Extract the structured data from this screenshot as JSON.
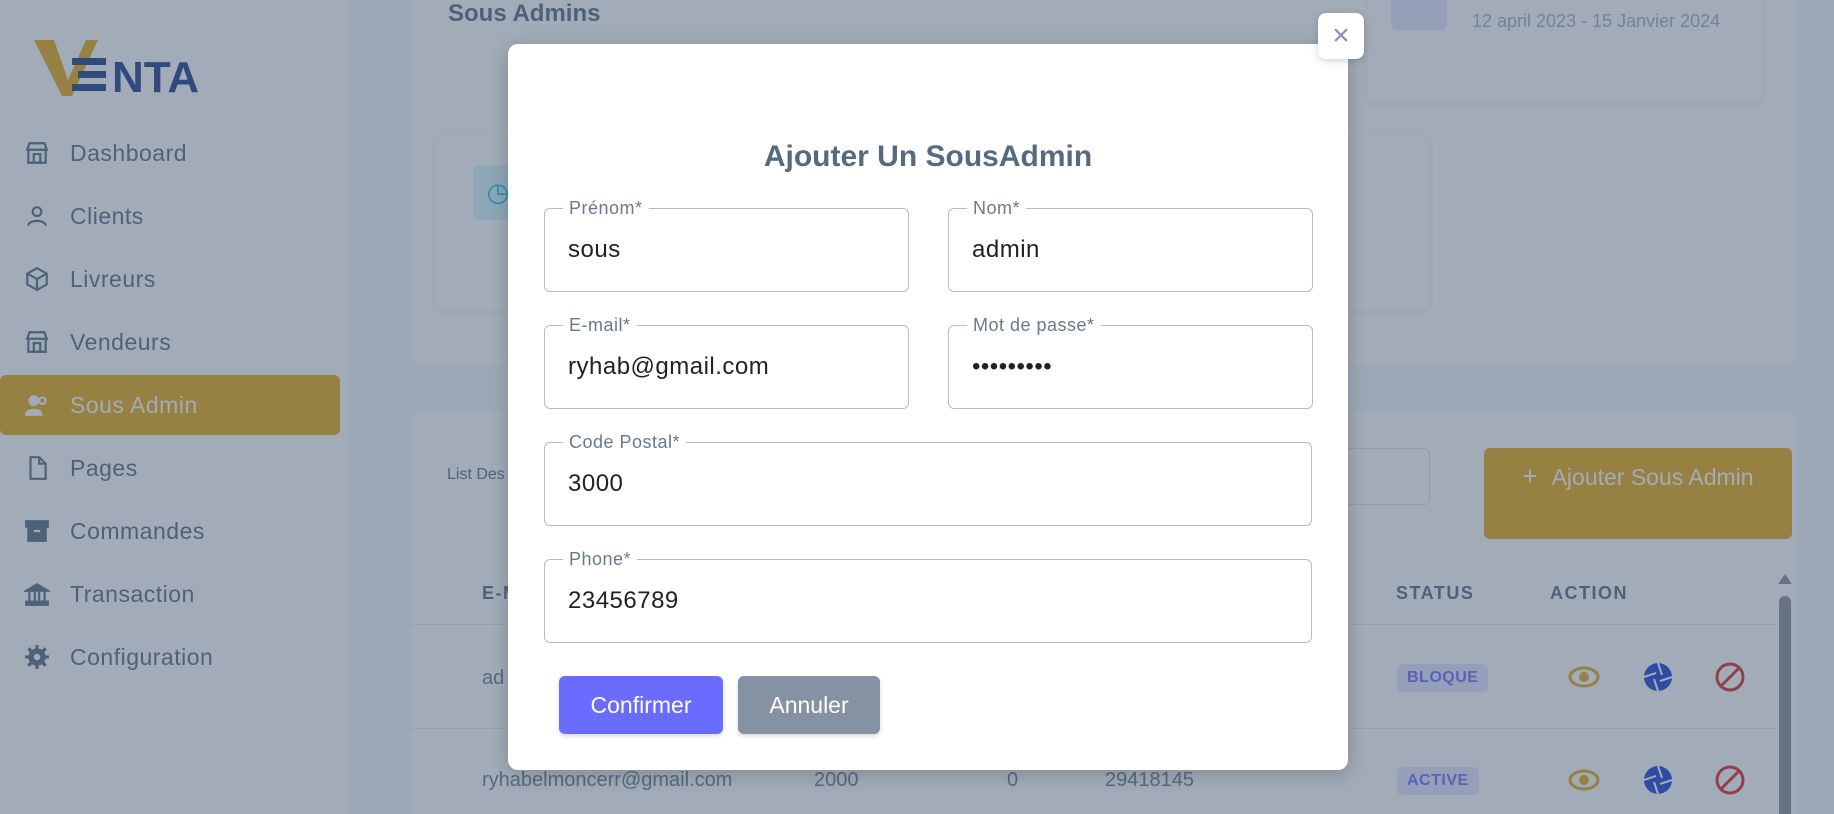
{
  "brand": {
    "logo_text": "VENTA",
    "accent": "#e8a814",
    "dark": "#1e3a8a"
  },
  "sidebar": {
    "items": [
      {
        "label": "Dashboard",
        "icon": "store-icon",
        "active": false
      },
      {
        "label": "Clients",
        "icon": "user-icon",
        "active": false
      },
      {
        "label": "Livreurs",
        "icon": "box-icon",
        "active": false
      },
      {
        "label": "Vendeurs",
        "icon": "store-icon",
        "active": false
      },
      {
        "label": "Sous Admin",
        "icon": "users-icon",
        "active": true
      },
      {
        "label": "Pages",
        "icon": "file-icon",
        "active": false
      },
      {
        "label": "Commandes",
        "icon": "archive-icon",
        "active": false
      },
      {
        "label": "Transaction",
        "icon": "bank-icon",
        "active": false
      },
      {
        "label": "Configuration",
        "icon": "gear-icon",
        "active": false
      }
    ]
  },
  "page": {
    "title": "Sous Admins",
    "date_range": "12 april 2023 - 15 Janvier 2024",
    "list_label": "List Des",
    "add_button": "Ajouter Sous Admin"
  },
  "table": {
    "headers": {
      "email": "E-M",
      "status": "STATUS",
      "action": "ACTION"
    },
    "rows": [
      {
        "email": "ad",
        "status": "BLOQUE"
      },
      {
        "email": "ryhabelmoncerr@gmail.com",
        "code_postal": "2000",
        "count": "0",
        "phone": "29418145",
        "status": "ACTIVE"
      }
    ]
  },
  "modal": {
    "title": "Ajouter Un SousAdmin",
    "close": "×",
    "fields": {
      "prenom": {
        "label": "Prénom*",
        "value": "sous"
      },
      "nom": {
        "label": "Nom*",
        "value": "admin"
      },
      "email": {
        "label": "E-mail*",
        "value": "ryhab@gmail.com"
      },
      "password": {
        "label": "Mot de passe*",
        "value": "•••••••••"
      },
      "code_postal": {
        "label": "Code Postal*",
        "value": "3000"
      },
      "phone": {
        "label": "Phone*",
        "value": "23456789"
      }
    },
    "confirm_button": "Confirmer",
    "cancel_button": "Annuler"
  }
}
